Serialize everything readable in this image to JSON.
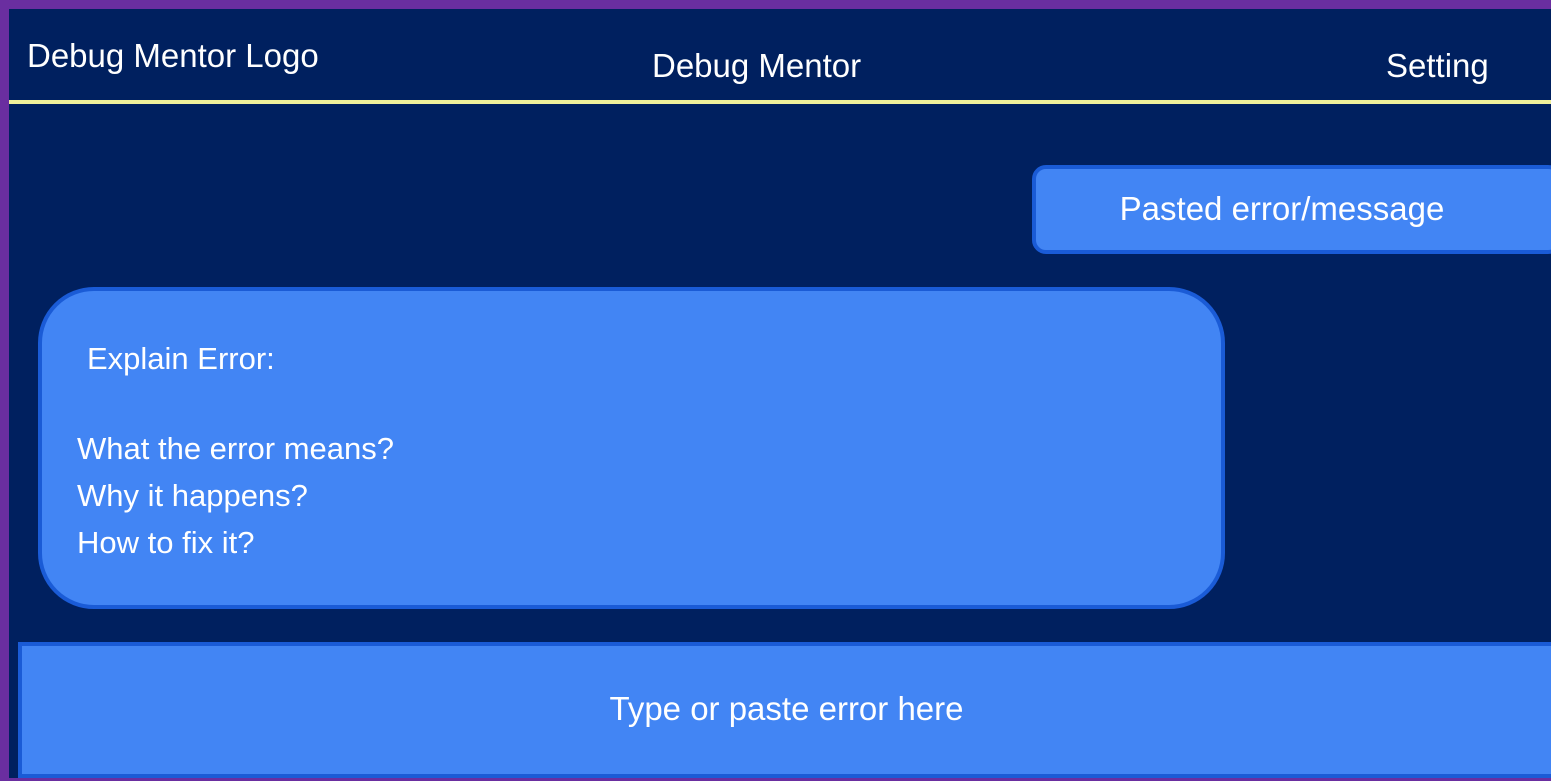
{
  "header": {
    "logo_text": "Debug Mentor Logo",
    "title": "Debug Mentor",
    "settings_label": "Setting"
  },
  "chat": {
    "user_message": "Pasted error/message",
    "bot_message": {
      "heading": "Explain Error:",
      "lines": [
        "What the error means?",
        "Why it happens?",
        "How to fix it?"
      ]
    }
  },
  "input": {
    "placeholder": "Type or paste error here"
  },
  "colors": {
    "background": "#00205f",
    "frame_border": "#6a2ea0",
    "header_divider": "#f0f09a",
    "bubble_fill": "#4285f4",
    "bubble_border": "#1a5bd6",
    "text": "#ffffff"
  }
}
